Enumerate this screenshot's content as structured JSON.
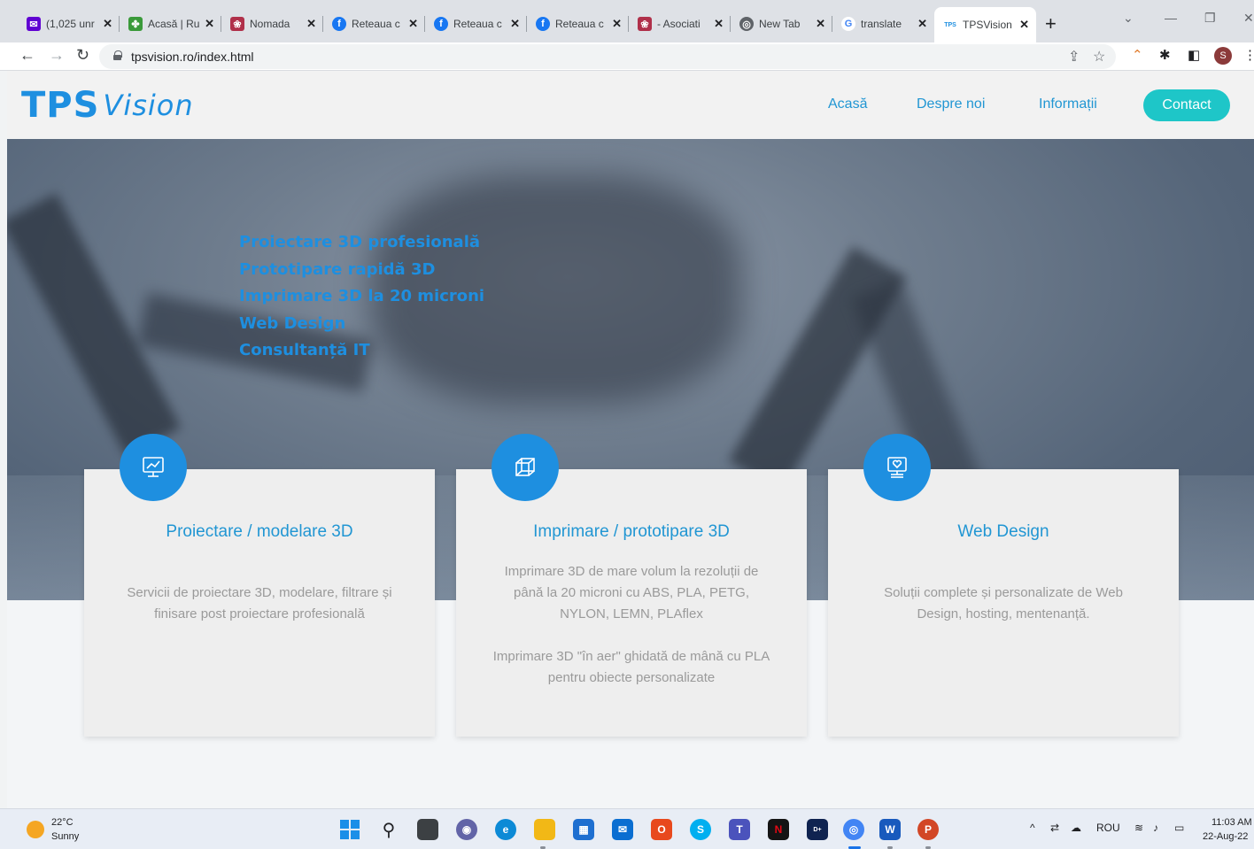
{
  "browser": {
    "tabs": [
      {
        "title": "(1,025 unr",
        "icon": "mail-icon",
        "color": "#6001d2"
      },
      {
        "title": "Acasă | Ru",
        "icon": "leaf-icon",
        "color": "#3a9a3a"
      },
      {
        "title": "Nomada",
        "icon": "flower-icon",
        "color": "#b0304a"
      },
      {
        "title": "Reteaua c",
        "icon": "facebook-icon",
        "color": "#1877f2"
      },
      {
        "title": "Reteaua c",
        "icon": "facebook-icon",
        "color": "#1877f2"
      },
      {
        "title": "Reteaua c",
        "icon": "facebook-icon",
        "color": "#1877f2"
      },
      {
        "title": "- Asociati",
        "icon": "flower-icon",
        "color": "#b0304a"
      },
      {
        "title": "New Tab",
        "icon": "chrome-icon",
        "color": "#5f6368"
      },
      {
        "title": "translate",
        "icon": "google-icon",
        "color": "#4285f4"
      },
      {
        "title": "TPSVision",
        "icon": "tps-icon",
        "color": "#1e8fe0"
      }
    ],
    "url": "tpsvision.ro/index.html",
    "profile_initial": "S"
  },
  "site": {
    "logo_tps": "TPS",
    "logo_vision": "Vision",
    "nav": {
      "home": "Acasă",
      "about": "Despre noi",
      "info": "Informații",
      "contact": "Contact"
    },
    "hero_items": [
      "Proiectare 3D profesională",
      "Prototipare rapidă 3D",
      "Imprimare 3D la 20 microni",
      "Web Design",
      "Consultanță IT"
    ],
    "cards": [
      {
        "title": "Proiectare / modelare 3D",
        "icon": "monitor-chart-icon",
        "text1": "Servicii de proiectare 3D, modelare, filtrare și finisare post proiectare profesională",
        "text2": ""
      },
      {
        "title": "Imprimare / prototipare 3D",
        "icon": "cube-icon",
        "text1": "Imprimare 3D de mare volum la rezoluții de până la 20 microni cu ABS, PLA, PETG, NYLON, LEMN, PLAflex",
        "text2": "Imprimare 3D \"în aer\" ghidată de mână cu PLA pentru obiecte personalizate"
      },
      {
        "title": "Web Design",
        "icon": "monitor-heart-icon",
        "text1": "Soluții complete și personalizate de Web Design, hosting, mentenanță.",
        "text2": ""
      }
    ],
    "colors": {
      "accent": "#1e8fe0",
      "contact_button": "#1ec6c8",
      "card_text": "#9a9a9a"
    }
  },
  "taskbar": {
    "weather_temp": "22°C",
    "weather_cond": "Sunny",
    "language": "ROU",
    "time": "11:03 AM",
    "date": "22-Aug-22"
  }
}
